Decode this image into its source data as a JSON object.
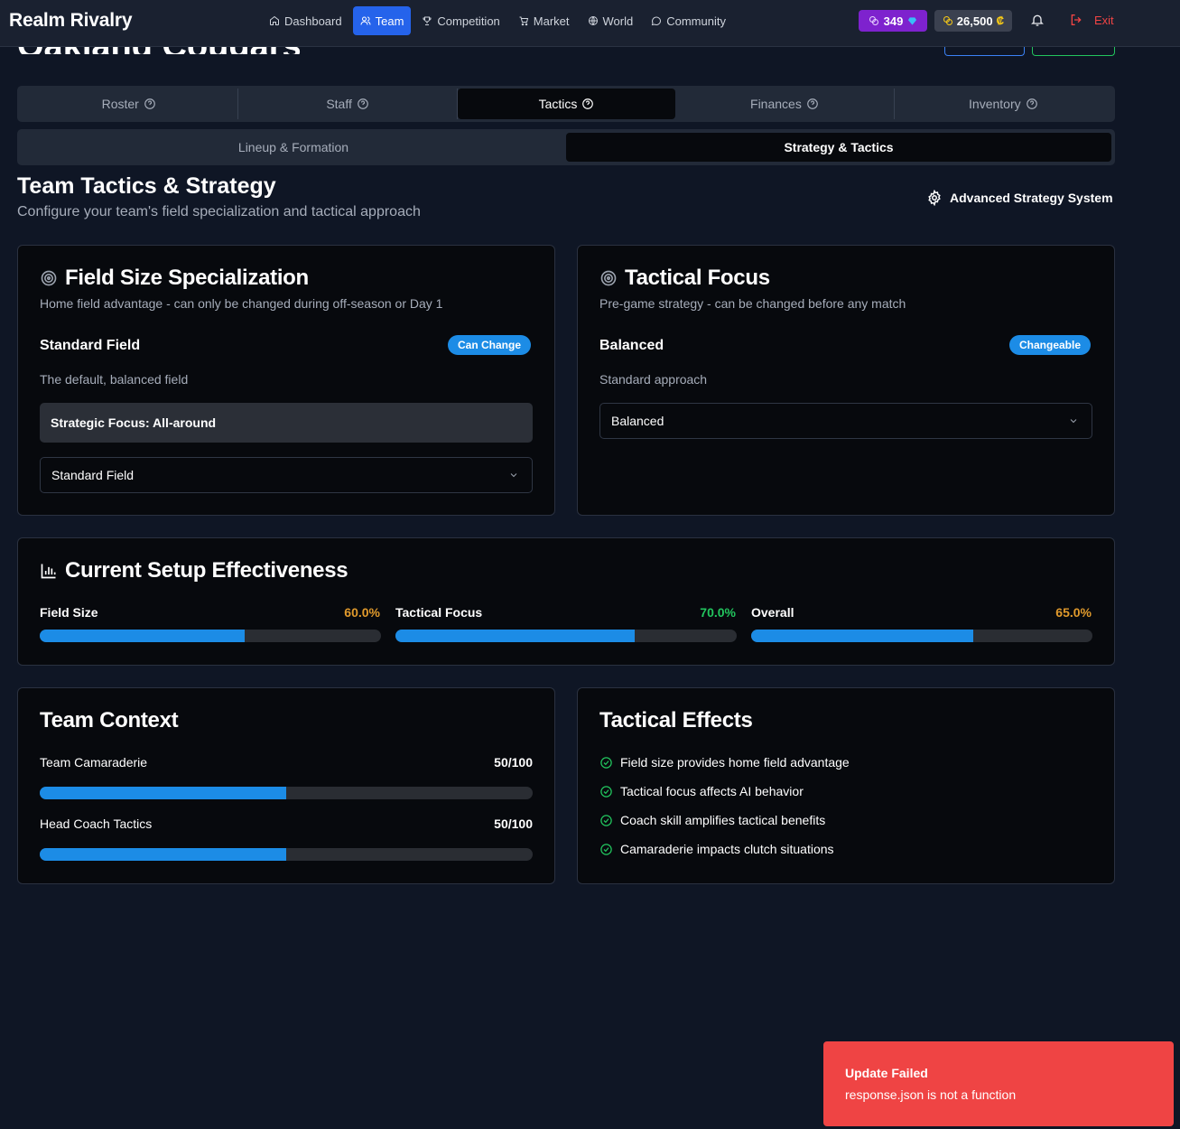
{
  "app": {
    "brand": "Realm Rivalry"
  },
  "nav": {
    "items": [
      {
        "label": "Dashboard",
        "icon": "home-icon"
      },
      {
        "label": "Team",
        "icon": "users-icon"
      },
      {
        "label": "Competition",
        "icon": "trophy-icon"
      },
      {
        "label": "Market",
        "icon": "cart-icon"
      },
      {
        "label": "World",
        "icon": "globe-icon"
      },
      {
        "label": "Community",
        "icon": "chat-icon"
      }
    ],
    "active": "Team",
    "gems": "349",
    "credits": "26,500",
    "exit_label": "Exit"
  },
  "header": {
    "team_name_cut": "Oakland Cougars"
  },
  "main_tabs": [
    {
      "label": "Roster"
    },
    {
      "label": "Staff"
    },
    {
      "label": "Tactics"
    },
    {
      "label": "Finances"
    },
    {
      "label": "Inventory"
    }
  ],
  "sub_tabs": [
    {
      "label": "Lineup & Formation"
    },
    {
      "label": "Strategy & Tactics"
    }
  ],
  "page": {
    "title": "Team Tactics & Strategy",
    "subtitle": "Configure your team's field specialization and tactical approach",
    "advanced_label": "Advanced Strategy System"
  },
  "field_card": {
    "title": "Field Size Specialization",
    "desc": "Home field advantage - can only be changed during off-season or Day 1",
    "current": "Standard Field",
    "badge": "Can Change",
    "current_desc": "The default, balanced field",
    "focus": "Strategic Focus: All-around",
    "select_value": "Standard Field"
  },
  "tactical_card": {
    "title": "Tactical Focus",
    "desc": "Pre-game strategy - can be changed before any match",
    "current": "Balanced",
    "badge": "Changeable",
    "current_desc": "Standard approach",
    "select_value": "Balanced"
  },
  "effectiveness": {
    "title": "Current Setup Effectiveness",
    "metrics": [
      {
        "label": "Field Size",
        "value": "60.0%",
        "fraction": 0.6,
        "color": "#e09a2c"
      },
      {
        "label": "Tactical Focus",
        "value": "70.0%",
        "fraction": 0.7,
        "color": "#22c55e"
      },
      {
        "label": "Overall",
        "value": "65.0%",
        "fraction": 0.65,
        "color": "#e09a2c"
      }
    ]
  },
  "team_context": {
    "title": "Team Context",
    "rows": [
      {
        "label": "Team Camaraderie",
        "value": "50/100",
        "fraction": 0.5
      },
      {
        "label": "Head Coach Tactics",
        "value": "50/100",
        "fraction": 0.5
      }
    ]
  },
  "tactical_effects": {
    "title": "Tactical Effects",
    "items": [
      "Field size provides home field advantage",
      "Tactical focus affects AI behavior",
      "Coach skill amplifies tactical benefits",
      "Camaraderie impacts clutch situations"
    ]
  },
  "toast": {
    "title": "Update Failed",
    "message": "response.json is not a function"
  }
}
